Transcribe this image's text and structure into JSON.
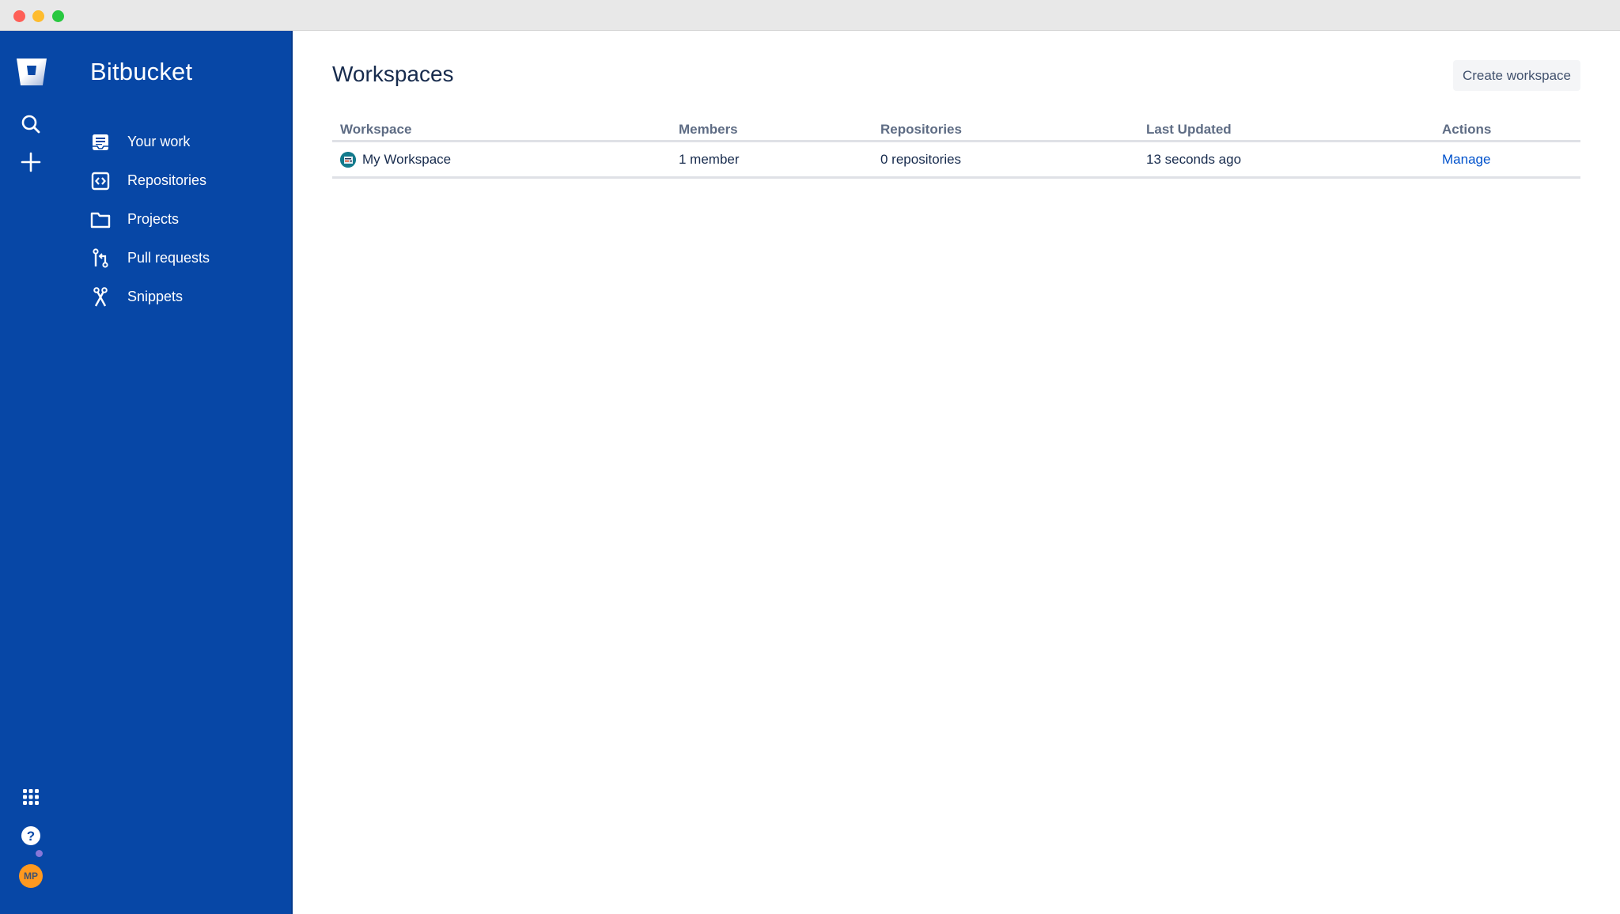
{
  "window": {
    "controls": [
      "close",
      "minimize",
      "maximize"
    ]
  },
  "sidebar": {
    "brand": "Bitbucket",
    "rail_icons": [
      "bitbucket-logo",
      "search-icon",
      "plus-icon"
    ],
    "items": [
      {
        "label": "Your work",
        "icon": "your-work-icon"
      },
      {
        "label": "Repositories",
        "icon": "repositories-icon"
      },
      {
        "label": "Projects",
        "icon": "projects-icon"
      },
      {
        "label": "Pull requests",
        "icon": "pull-requests-icon"
      },
      {
        "label": "Snippets",
        "icon": "snippets-icon"
      }
    ],
    "bottom": {
      "apps_icon": "app-switcher-icon",
      "help_icon": "help-icon",
      "avatar_initials": "MP",
      "avatar_color": "#ff991f"
    }
  },
  "colors": {
    "sidebar_bg": "#0747a6",
    "link": "#0052cc",
    "title": "#172b4d",
    "header_text": "#5e6c84"
  },
  "main": {
    "title": "Workspaces",
    "create_button": "Create workspace",
    "table": {
      "columns": [
        "Workspace",
        "Members",
        "Repositories",
        "Last Updated",
        "Actions"
      ],
      "rows": [
        {
          "workspace": "My Workspace",
          "members": "1 member",
          "repositories": "0 repositories",
          "last_updated": "13 seconds ago",
          "action": "Manage"
        }
      ]
    }
  }
}
